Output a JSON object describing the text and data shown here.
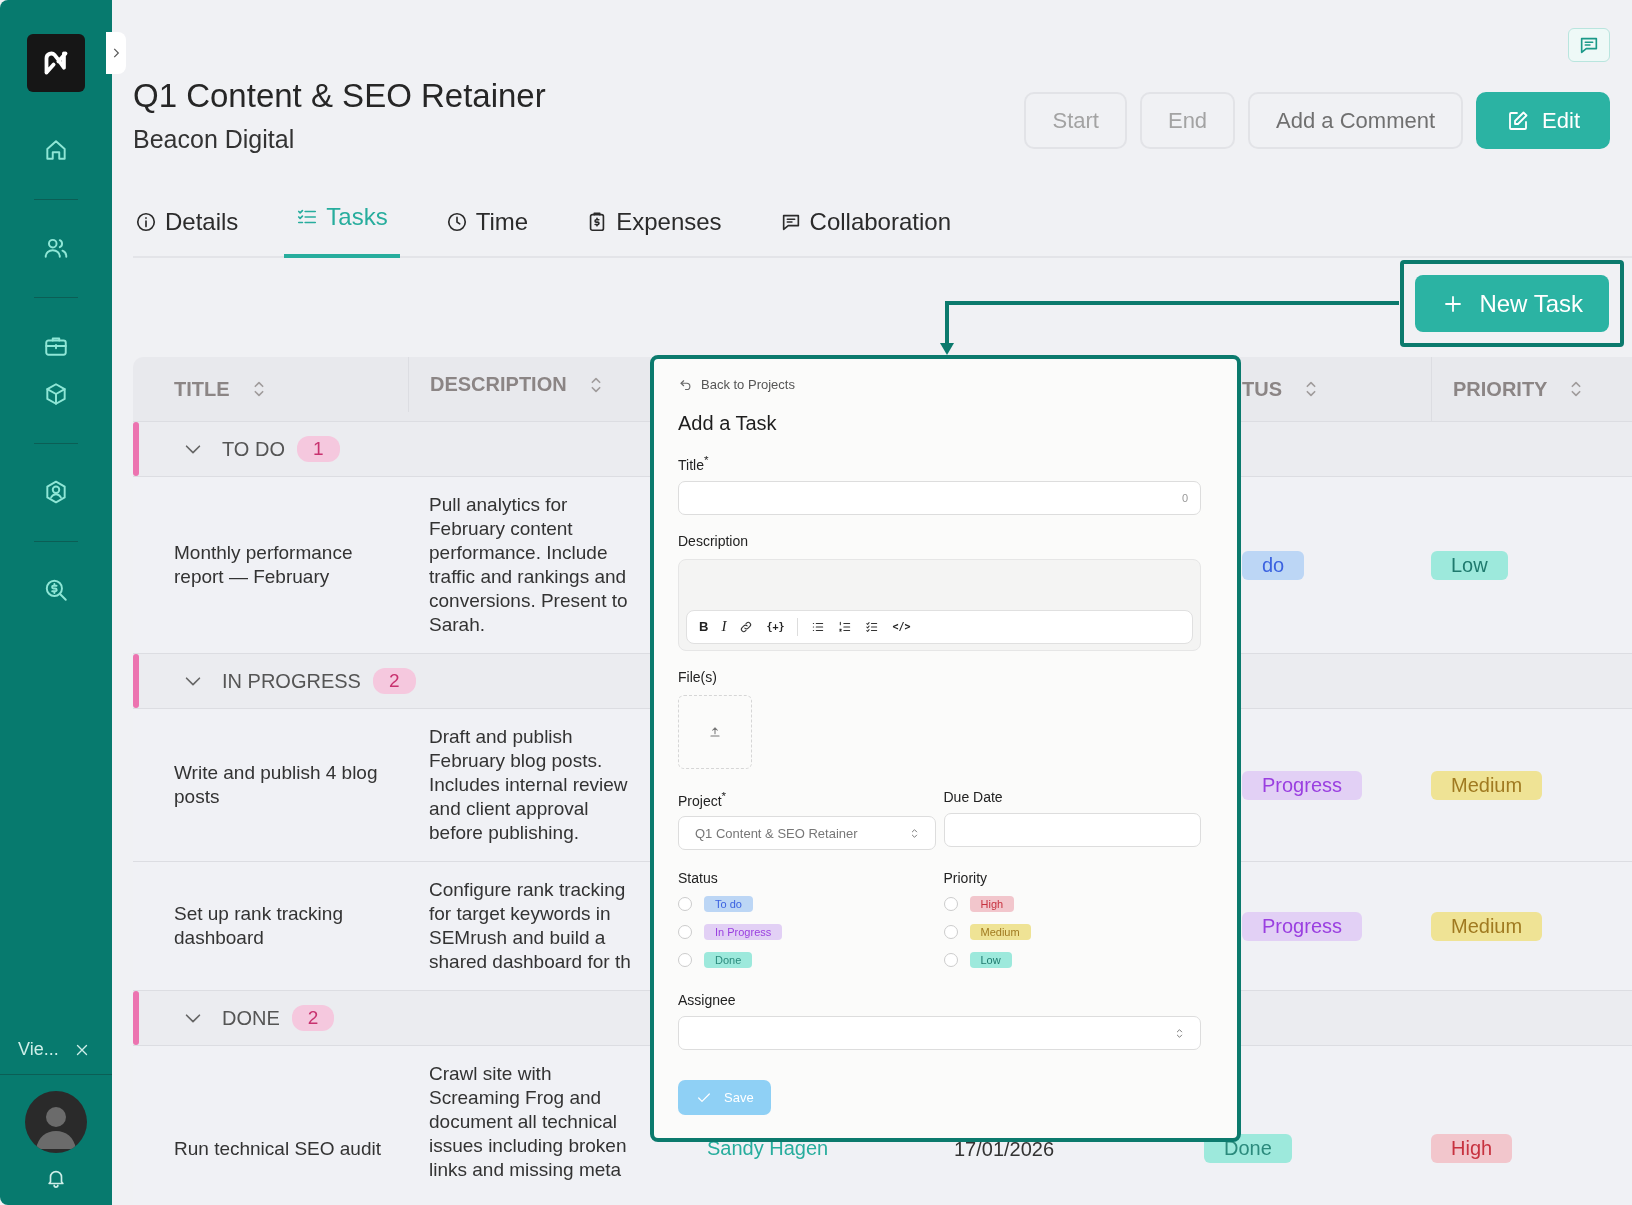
{
  "sidebar": {
    "footer_label": "Vie..."
  },
  "header": {
    "title": "Q1 Content & SEO Retainer",
    "subtitle": "Beacon Digital",
    "buttons": [
      {
        "label": "Start",
        "kind": "plain",
        "disabled": true
      },
      {
        "label": "End",
        "kind": "plain",
        "disabled": true
      },
      {
        "label": "Add a Comment",
        "kind": "plain",
        "disabled": false
      },
      {
        "label": "Edit",
        "kind": "primary",
        "disabled": false
      }
    ]
  },
  "tabs": [
    {
      "label": "Details",
      "selected": false
    },
    {
      "label": "Tasks",
      "selected": true
    },
    {
      "label": "Time",
      "selected": false
    },
    {
      "label": "Expenses",
      "selected": false
    },
    {
      "label": "Collaboration",
      "selected": false
    }
  ],
  "new_task_button": {
    "label": "New Task"
  },
  "table": {
    "columns": [
      {
        "label": "TITLE"
      },
      {
        "label": "DESCRIPTION"
      },
      {
        "label": "TUS"
      },
      {
        "label": "PRIORITY"
      }
    ],
    "groups": [
      {
        "label": "TO DO",
        "count": "1",
        "expanded": true,
        "rows": [
          {
            "title": "Monthly performance report — February",
            "description": "Pull analytics for\nFebruary content\nperformance. Include\ntraffic and rankings and\nconversions. Present to\nSarah.",
            "status": {
              "text": "do",
              "kind": "todo"
            },
            "priority": {
              "text": "Low",
              "kind": "low"
            }
          }
        ]
      },
      {
        "label": "IN PROGRESS",
        "count": "2",
        "expanded": true,
        "rows": [
          {
            "title": "Write and publish 4 blog posts",
            "description": "Draft and publish\nFebruary blog posts.\nIncludes internal review\nand client approval\nbefore publishing.",
            "status": {
              "text": "Progress",
              "kind": "progress"
            },
            "priority": {
              "text": "Medium",
              "kind": "medium"
            }
          },
          {
            "title": "Set up rank tracking dashboard",
            "description": "Configure rank tracking\nfor target keywords in\nSEMrush and build a\nshared dashboard for th",
            "status": {
              "text": "Progress",
              "kind": "progress"
            },
            "priority": {
              "text": "Medium",
              "kind": "medium"
            }
          }
        ]
      },
      {
        "label": "DONE",
        "count": "2",
        "expanded": true,
        "rows": [
          {
            "title": "Run technical SEO audit",
            "description": "Crawl site with\nScreaming Frog and\ndocument all technical\nissues including broken\nlinks and missing meta",
            "assignee": "Sandy Hagen",
            "due_date": "17/01/2026",
            "status": {
              "text": "Done",
              "kind": "done"
            },
            "priority": {
              "text": "High",
              "kind": "high"
            }
          }
        ]
      }
    ]
  },
  "modal": {
    "back_link": "Back to Projects",
    "title": "Add a Task",
    "title_field": {
      "label": "Title$^{*}$",
      "counter": "0"
    },
    "description_field": {
      "label": "Description",
      "toolbar": [
        {
          "kind": "bold",
          "label": "B"
        },
        {
          "kind": "italic",
          "label": "I"
        },
        {
          "kind": "link"
        },
        {
          "kind": "variable",
          "label": "{+}"
        },
        {
          "kind": "divider"
        },
        {
          "kind": "bullets"
        },
        {
          "kind": "numbers"
        },
        {
          "kind": "checklist"
        },
        {
          "kind": "code",
          "label": "</>"
        }
      ]
    },
    "files_field": {
      "label": "File(s)"
    },
    "project_field": {
      "label": "Project$^{*}$",
      "value": "Q1 Content & SEO Retainer",
      "disabled": true
    },
    "due_date_field": {
      "label": "Due Date"
    },
    "status_field": {
      "label": "Status",
      "options": [
        {
          "label": "To do",
          "kind": "todo",
          "selected": false
        },
        {
          "label": "In Progress",
          "kind": "progress",
          "selected": false
        },
        {
          "label": "Done",
          "kind": "done",
          "selected": false
        }
      ]
    },
    "priority_field": {
      "label": "Priority",
      "options": [
        {
          "label": "High",
          "kind": "high",
          "selected": false
        },
        {
          "label": "Medium",
          "kind": "medium",
          "selected": false
        },
        {
          "label": "Low",
          "kind": "low",
          "selected": false
        }
      ]
    },
    "assignee_field": {
      "label": "Assignee"
    },
    "save_button": {
      "label": "Save",
      "disabled": true
    }
  }
}
